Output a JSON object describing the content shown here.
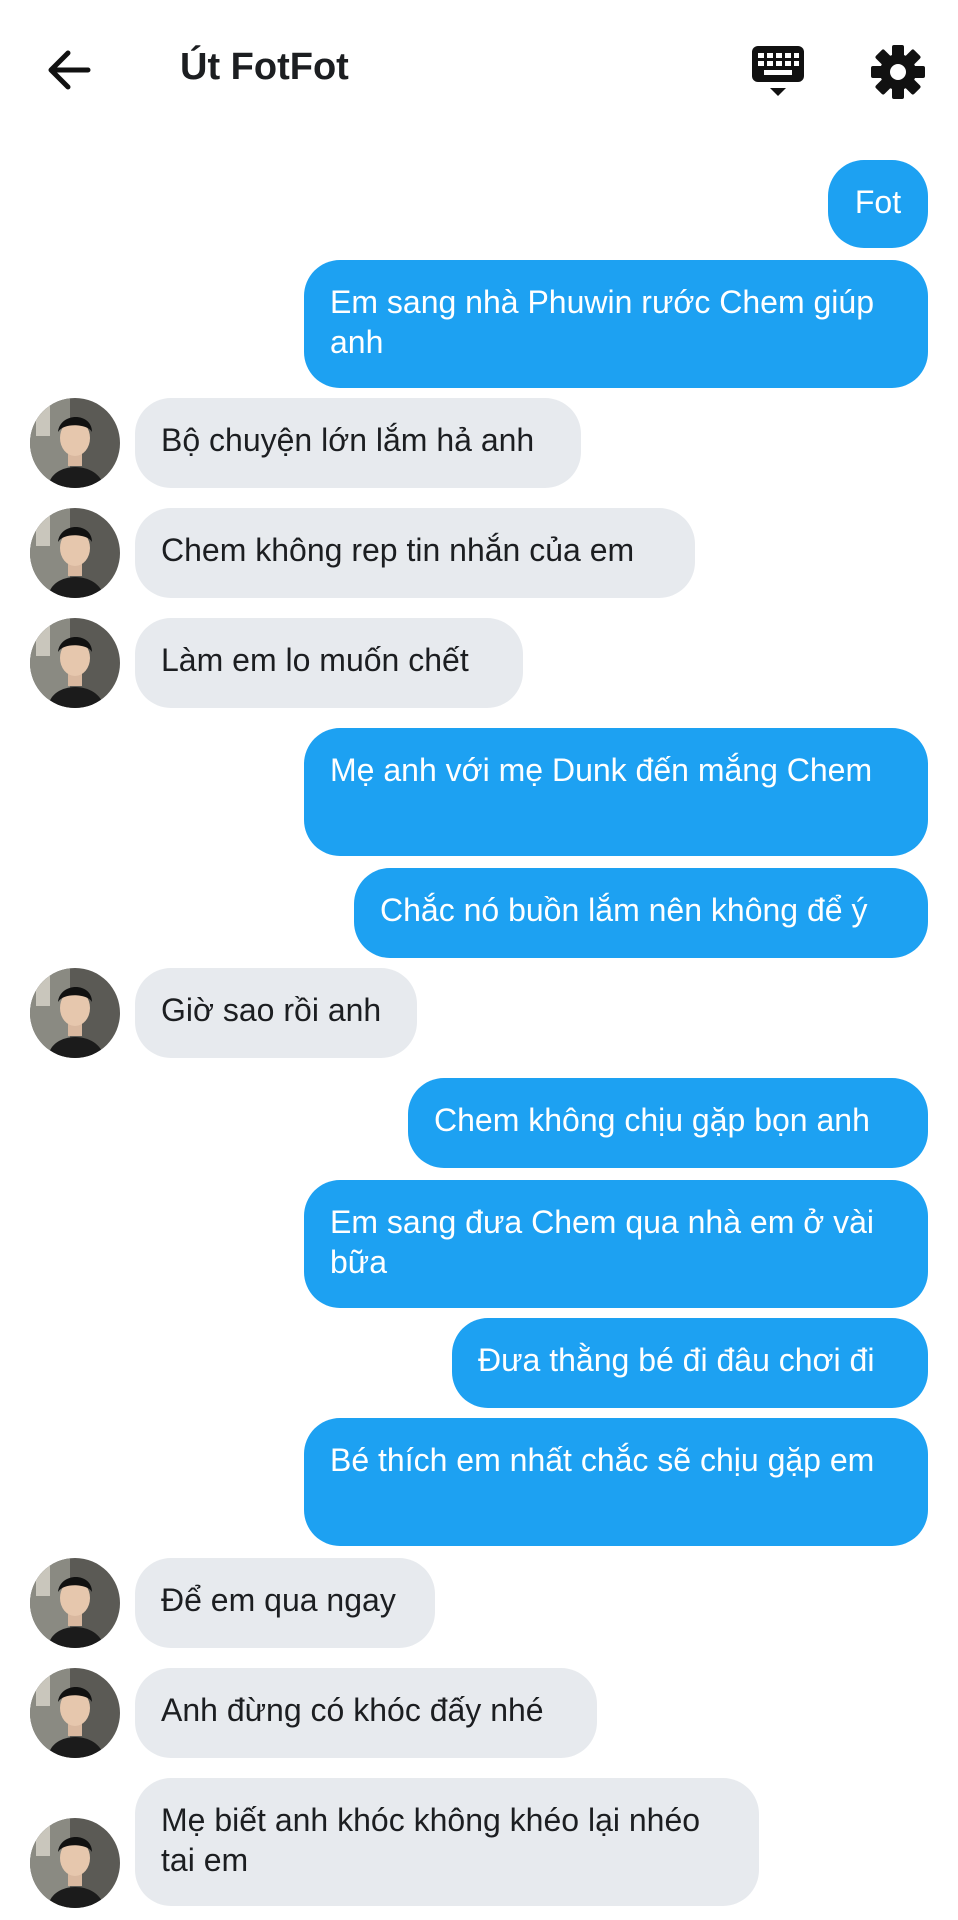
{
  "header": {
    "title": "Út FotFot",
    "back_icon": "arrow-left-icon",
    "keyboard_icon": "keyboard-icon",
    "settings_icon": "gear-icon"
  },
  "colors": {
    "outgoing": "#1da1f2",
    "incoming": "#e7eaee"
  },
  "messages": [
    {
      "dir": "out",
      "text": "Fot"
    },
    {
      "dir": "out",
      "text": "Em sang nhà Phuwin rước Chem giúp anh"
    },
    {
      "dir": "in",
      "text": "Bộ chuyện lớn lắm hả anh"
    },
    {
      "dir": "in",
      "text": "Chem không rep tin nhắn của em"
    },
    {
      "dir": "in",
      "text": "Làm em lo muốn chết"
    },
    {
      "dir": "out",
      "text": "Mẹ anh với mẹ Dunk đến mắng Chem"
    },
    {
      "dir": "out",
      "text": "Chắc nó buồn lắm nên không để ý"
    },
    {
      "dir": "in",
      "text": "Giờ sao rồi anh"
    },
    {
      "dir": "out",
      "text": "Chem không chịu gặp bọn anh"
    },
    {
      "dir": "out",
      "text": "Em sang đưa Chem qua nhà em ở vài bữa"
    },
    {
      "dir": "out",
      "text": "Đưa thằng bé đi đâu chơi đi"
    },
    {
      "dir": "out",
      "text": "Bé thích em nhất chắc sẽ chịu gặp em"
    },
    {
      "dir": "in",
      "text": "Để em qua ngay"
    },
    {
      "dir": "in",
      "text": "Anh đừng có khóc đấy nhé"
    },
    {
      "dir": "in",
      "text": "Mẹ biết anh khóc không khéo lại nhéo tai em"
    }
  ]
}
